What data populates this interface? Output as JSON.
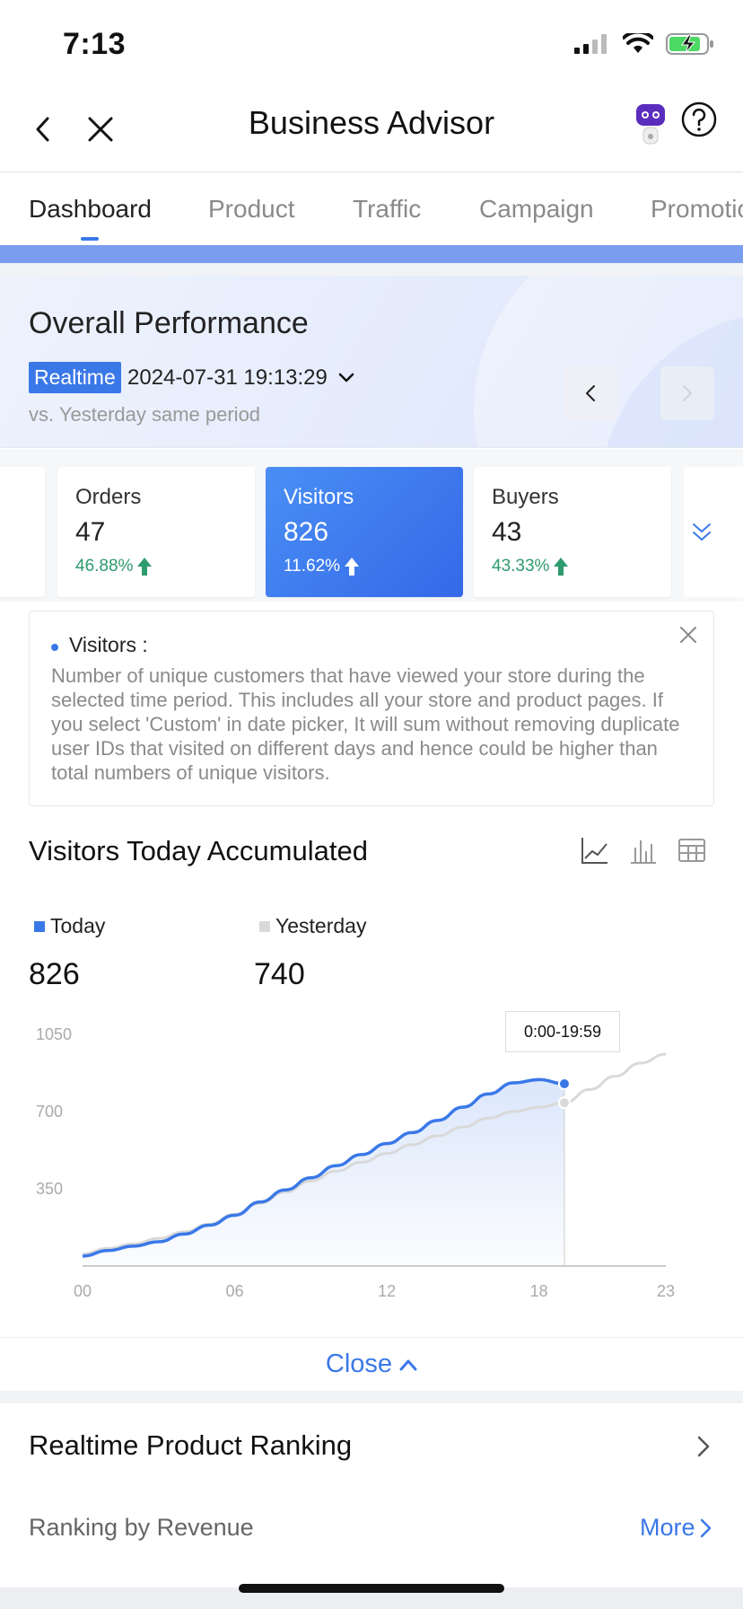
{
  "status_bar": {
    "time": "7:13"
  },
  "nav": {
    "title": "Business Advisor"
  },
  "tabs": [
    "Dashboard",
    "Product",
    "Traffic",
    "Campaign",
    "Promotio"
  ],
  "performance": {
    "title": "Overall Performance",
    "badge": "Realtime",
    "datetime": "2024-07-31 19:13:29",
    "comparison": "vs. Yesterday same period"
  },
  "metrics": [
    {
      "label": "Orders",
      "value": "47",
      "change": "46.88%"
    },
    {
      "label": "Visitors",
      "value": "826",
      "change": "11.62%"
    },
    {
      "label": "Buyers",
      "value": "43",
      "change": "43.33%"
    }
  ],
  "explain": {
    "title": "Visitors :",
    "body": "Number of unique customers that have viewed your store during the selected time period. This includes all your store and product pages. If you select 'Custom' in date picker,  It will sum without removing duplicate user IDs that visited on different days and hence could be higher than total numbers of unique visitors."
  },
  "visitors_chart": {
    "title": "Visitors Today Accumulated",
    "legend": [
      {
        "name": "Today",
        "value": "826",
        "color": "#3a78e8"
      },
      {
        "name": "Yesterday",
        "value": "740",
        "color": "#d9d9d9"
      }
    ],
    "tooltip": "0:00-19:59"
  },
  "chart_data": {
    "type": "area",
    "title": "Visitors Today Accumulated",
    "xlabel": "",
    "ylabel": "",
    "x_tick_labels": [
      "00",
      "06",
      "12",
      "18",
      "23"
    ],
    "y_tick_labels": [
      "350",
      "700",
      "1050"
    ],
    "ylim": [
      0,
      1050
    ],
    "xlim": [
      0,
      23
    ],
    "grid": false,
    "series": [
      {
        "name": "Today",
        "color": "#3a78e8",
        "x": [
          0,
          1,
          2,
          3,
          4,
          5,
          6,
          7,
          8,
          9,
          10,
          11,
          12,
          13,
          14,
          15,
          16,
          17,
          18,
          19
        ],
        "values": [
          45,
          70,
          90,
          110,
          145,
          185,
          230,
          290,
          345,
          400,
          455,
          505,
          555,
          605,
          660,
          720,
          780,
          830,
          845,
          826
        ]
      },
      {
        "name": "Yesterday",
        "color": "#d9d9d9",
        "x": [
          0,
          1,
          2,
          3,
          4,
          5,
          6,
          7,
          8,
          9,
          10,
          11,
          12,
          13,
          14,
          15,
          16,
          17,
          18,
          19,
          20,
          21,
          22,
          23
        ],
        "values": [
          55,
          80,
          100,
          125,
          155,
          190,
          235,
          285,
          335,
          385,
          430,
          470,
          510,
          550,
          590,
          630,
          670,
          700,
          720,
          740,
          800,
          860,
          920,
          960
        ]
      }
    ]
  },
  "close_label": "Close",
  "ranking": {
    "title": "Realtime Product Ranking",
    "subtitle": "Ranking by Revenue",
    "more": "More"
  },
  "colors": {
    "accent": "#3a78e8",
    "positive": "#2e9a6f"
  }
}
